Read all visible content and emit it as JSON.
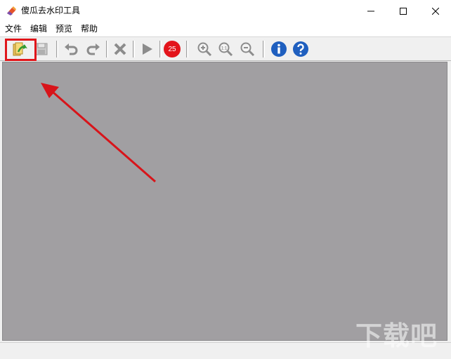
{
  "window": {
    "title": "傻瓜去水印工具"
  },
  "menu": {
    "items": [
      "文件",
      "编辑",
      "预览",
      "帮助"
    ]
  },
  "toolbar": {
    "open_icon": "open-image-icon",
    "save_icon": "save-icon",
    "undo_icon": "undo-icon",
    "redo_icon": "redo-icon",
    "delete_icon": "delete-icon",
    "run_icon": "play-icon",
    "brush_size": "25",
    "zoom_in_icon": "zoom-in-icon",
    "zoom_actual_label": "1:1",
    "zoom_out_icon": "zoom-out-icon",
    "info_icon": "info-icon",
    "help_icon": "help-icon"
  },
  "watermark": {
    "text": "下载吧"
  },
  "colors": {
    "canvas": "#a19fa2",
    "highlight": "#e0161b",
    "arrow": "#d8141a",
    "badge": "#e3141b"
  }
}
